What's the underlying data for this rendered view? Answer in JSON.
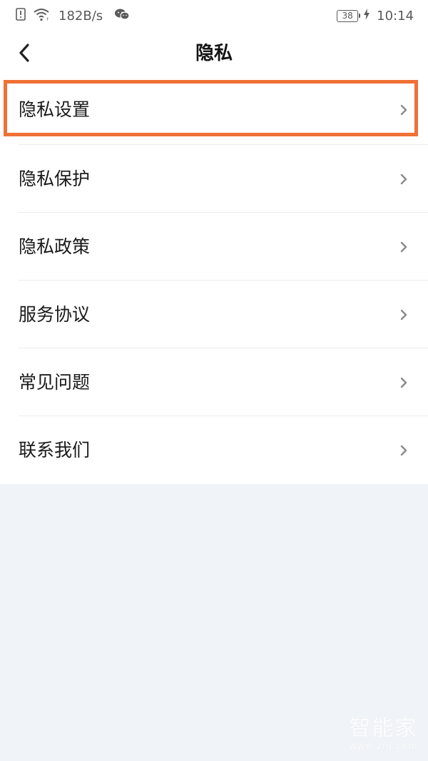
{
  "status_bar": {
    "network_speed": "182B/s",
    "battery_level": "38",
    "time": "10:14",
    "icons": [
      "sim-alert-icon",
      "wifi-icon",
      "wechat-icon",
      "battery-icon",
      "charging-icon"
    ]
  },
  "header": {
    "title": "隐私",
    "back_icon": "chevron-left-icon"
  },
  "menu": {
    "items": [
      {
        "label": "隐私设置",
        "highlighted": true
      },
      {
        "label": "隐私保护"
      },
      {
        "label": "隐私政策"
      },
      {
        "label": "服务协议"
      },
      {
        "label": "常见问题"
      },
      {
        "label": "联系我们"
      }
    ],
    "chevron_icon": "chevron-right-icon"
  },
  "watermark": {
    "brand": "智能家",
    "url": "www.znj.com"
  },
  "colors": {
    "highlight_border": "#f07035",
    "page_background": "#f0f3f7",
    "row_background": "#ffffff"
  }
}
